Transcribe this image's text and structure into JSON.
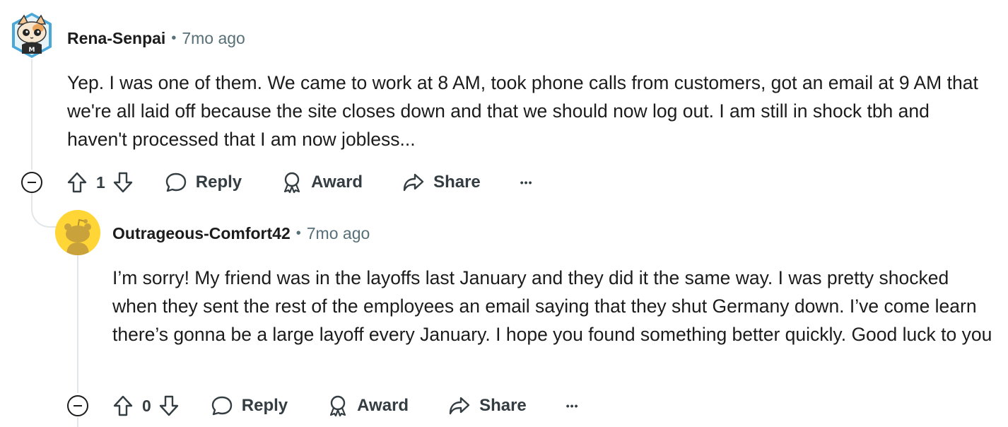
{
  "comments": [
    {
      "username": "Rena-Senpai",
      "separator": "•",
      "time": "7mo ago",
      "avatar_icon": "cat-avatar-icon",
      "body": "Yep. I was one of them. We came to work at 8 AM, took phone calls from customers, got an email at 9 AM that we're all laid off because the site closes down and that we should now log out. I am still in shock tbh and haven't processed that I am now jobless...",
      "score": "1",
      "reply_label": "Reply",
      "award_label": "Award",
      "share_label": "Share",
      "more_label": "•••"
    },
    {
      "username": "Outrageous-Comfort42",
      "separator": "•",
      "time": "7mo ago",
      "avatar_icon": "snoo-avatar-icon",
      "body": "I’m sorry! My friend was in the layoffs last January and they did it the same way. I was pretty shocked when they sent the rest of the employees an email saying that they shut Germany down. I’ve come learn there’s gonna be a large layoff every January. I hope you found something better quickly. Good luck to you",
      "score": "0",
      "reply_label": "Reply",
      "award_label": "Award",
      "share_label": "Share",
      "more_label": "•••"
    }
  ],
  "colors": {
    "text": "#1c1c1c",
    "meta": "#576f76",
    "action": "#333d42",
    "thread_line": "#e3e6e8",
    "avatar_yellow": "#ffd635",
    "snoo_body": "#c9a23b"
  }
}
